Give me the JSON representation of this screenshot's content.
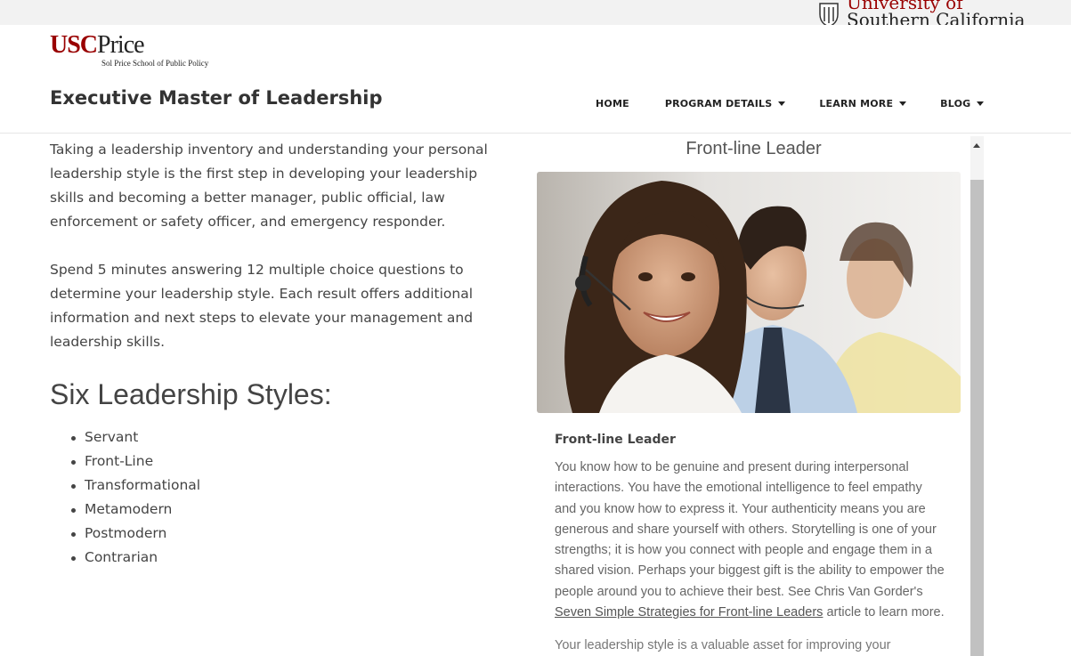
{
  "topbar": {
    "university_line1": "University of",
    "university_line2": "Southern California"
  },
  "header": {
    "brand_usc": "USC",
    "brand_price": "Price",
    "brand_sub": "Sol Price School of Public Policy",
    "site_title": "Executive Master of Leadership"
  },
  "nav": {
    "items": [
      {
        "label": "HOME",
        "dropdown": false
      },
      {
        "label": "PROGRAM DETAILS",
        "dropdown": true
      },
      {
        "label": "LEARN MORE",
        "dropdown": true
      },
      {
        "label": "BLOG",
        "dropdown": true
      }
    ]
  },
  "main": {
    "paragraph1": "Taking a leadership inventory and understanding your personal leadership style is the first step in developing your leadership skills and becoming a better manager, public official, law enforcement or safety officer, and emergency responder.",
    "paragraph2": "Spend 5 minutes answering 12 multiple choice questions to determine your leadership style. Each result offers additional information and next steps to elevate your management and leadership skills.",
    "styles_heading": "Six Leadership Styles:",
    "styles": [
      "Servant",
      "Front-Line",
      "Transformational",
      "Metamodern",
      "Postmodern",
      "Contrarian"
    ]
  },
  "result": {
    "title": "Front-line Leader",
    "subtitle": "Front-line Leader",
    "body_text": "You know how to be genuine and present during interpersonal interactions. You have the emotional intelligence to feel empathy and you know how to express it. Your authenticity means you are generous and share yourself with others. Storytelling is one of your strengths; it is how you connect with people and engage them in a shared vision. Perhaps your biggest gift is the ability to empower the people around you to achieve their best. See Chris Van Gorder's ",
    "link_text": "Seven Simple Strategies for Front-line Leaders",
    "body_end": " article to learn more.",
    "continuation": "Your leadership style is a valuable asset for improving your"
  },
  "colors": {
    "usc_cardinal": "#990000",
    "text": "#444444",
    "scroll_thumb": "#c1c1c1"
  }
}
